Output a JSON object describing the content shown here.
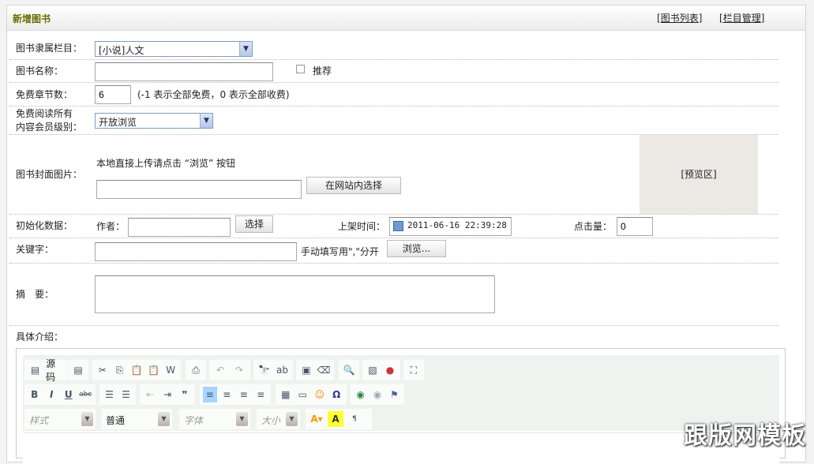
{
  "header": {
    "title": "新增图书",
    "link_list": "图书列表",
    "link_columns": "栏目管理"
  },
  "form": {
    "category": {
      "label": "图书隶属栏目：",
      "value": "[小说]人文"
    },
    "name": {
      "label": "图书名称：",
      "value": "",
      "recommend_label": "推荐"
    },
    "free_chapters": {
      "label": "免费章节数：",
      "value": "6",
      "hint": "(-1 表示全部免费，0 表示全部收费)"
    },
    "member_level": {
      "label_line1": "免费阅读所有",
      "label_line2": "内容会员级别：",
      "value": "开放浏览"
    },
    "cover": {
      "label": "图书封面图片：",
      "hint": "本地直接上传请点击 “浏览” 按钮",
      "value": "",
      "select_button": "在网站内选择",
      "preview": "[预览区]"
    },
    "init": {
      "label": "初始化数据：",
      "author_label": "作者：",
      "author_value": "",
      "choose_button": "选择",
      "time_label": "上架时间：",
      "time_value": "2011-06-16 22:39:28",
      "clicks_label": "点击量：",
      "clicks_value": "0"
    },
    "keywords": {
      "label": "关键字：",
      "value": "",
      "hint": "手动填写用\",\"分开",
      "browse_button": "浏览..."
    },
    "summary": {
      "label": "摘　要：",
      "value": ""
    },
    "intro": {
      "label": "具体介绍："
    }
  },
  "editor": {
    "source_label": "源码",
    "style": "样式",
    "format": "普通",
    "font": "字体",
    "size": "大小"
  },
  "watermark": "跟版网模板"
}
